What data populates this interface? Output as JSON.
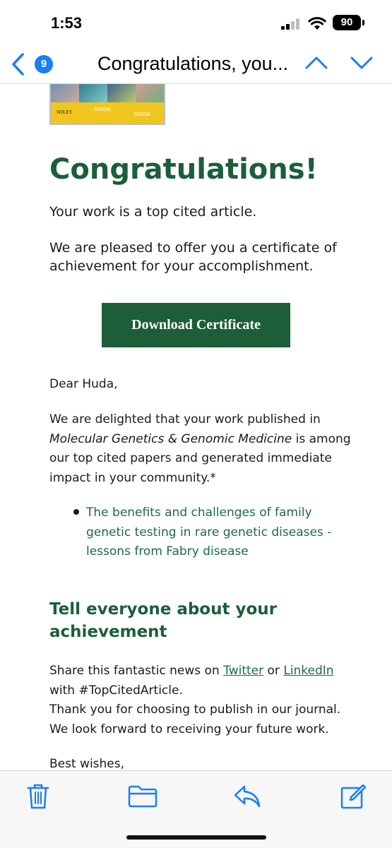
{
  "status": {
    "time": "1:53",
    "battery": "90"
  },
  "nav": {
    "back_count": "9",
    "title": "Congratulations, you..."
  },
  "email": {
    "banner": {
      "publisher": "WILEY",
      "journal_abbrev": "MGGM"
    },
    "headline": "Congratulations!",
    "intro": "Your work is a top cited article.",
    "offer": "We are pleased to offer you a certificate of achievement for your accomplishment.",
    "cta_label": "Download Certificate",
    "greeting": "Dear Huda,",
    "body_start": "We are delighted that your work published in",
    "journal_name": "Molecular Genetics & Genomic Medicine",
    "body_end": "is among our top cited papers and generated immediate impact in your community.*",
    "article_title": "The benefits and challenges of family genetic testing in rare genetic diseases - lessons from Fabry disease",
    "share_heading": "Tell everyone about your achievement",
    "share_prefix": "Share this fantastic news on",
    "twitter_link": "Twitter",
    "or_word": "or",
    "linkedin_link": "LinkedIn",
    "hashtag_text": "with #TopCitedArticle.",
    "thanks": "Thank you for choosing to publish in our journal.",
    "future": "We look forward to receiving your future work.",
    "signoff": "Best wishes,"
  },
  "toolbar": {
    "icons": [
      "trash-icon",
      "folder-icon",
      "reply-icon",
      "compose-icon"
    ],
    "accent": "#1a7ef5"
  },
  "colors": {
    "brand_green": "#1b5e37",
    "link_green": "#1e6a44",
    "ios_blue": "#1a7ef5"
  }
}
